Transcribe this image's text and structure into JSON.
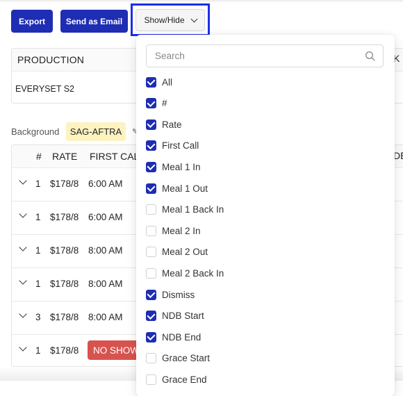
{
  "toolbar": {
    "export_label": "Export",
    "email_label": "Send as Email",
    "showhide_label": "Show/Hide"
  },
  "production": {
    "header": "PRODUCTION",
    "value": "EVERYSET S2",
    "next_header_partial": "K"
  },
  "group": {
    "label": "Background",
    "union_badge": "SAG-AFTRA"
  },
  "table": {
    "columns": [
      "#",
      "RATE",
      "FIRST CAL"
    ],
    "partial_column": "DE",
    "rows": [
      {
        "count": "1",
        "rate": "$178/8",
        "first_call": "6:00 AM",
        "status": ""
      },
      {
        "count": "1",
        "rate": "$178/8",
        "first_call": "6:00 AM",
        "status": ""
      },
      {
        "count": "1",
        "rate": "$178/8",
        "first_call": "8:00 AM",
        "status": ""
      },
      {
        "count": "1",
        "rate": "$178/8",
        "first_call": "8:00 AM",
        "status": ""
      },
      {
        "count": "3",
        "rate": "$178/8",
        "first_call": "8:00 AM",
        "status": ""
      },
      {
        "count": "1",
        "rate": "$178/8",
        "first_call": "",
        "status": "NO SHOW"
      }
    ]
  },
  "dropdown": {
    "search_placeholder": "Search",
    "search_value": "",
    "options": [
      {
        "label": "All",
        "checked": true
      },
      {
        "label": "#",
        "checked": true
      },
      {
        "label": "Rate",
        "checked": true
      },
      {
        "label": "First Call",
        "checked": true
      },
      {
        "label": "Meal 1 In",
        "checked": true
      },
      {
        "label": "Meal 1 Out",
        "checked": true
      },
      {
        "label": "Meal 1 Back In",
        "checked": false
      },
      {
        "label": "Meal 2 In",
        "checked": false
      },
      {
        "label": "Meal 2 Out",
        "checked": false
      },
      {
        "label": "Meal 2 Back In",
        "checked": false
      },
      {
        "label": "Dismiss",
        "checked": true
      },
      {
        "label": "NDB Start",
        "checked": true
      },
      {
        "label": "NDB End",
        "checked": true
      },
      {
        "label": "Grace Start",
        "checked": false
      },
      {
        "label": "Grace End",
        "checked": false
      }
    ]
  },
  "colors": {
    "primary": "#1e2db3",
    "highlight_border": "#1c2ee8",
    "badge_bg": "#fcf3c0",
    "no_show": "#d8534f"
  }
}
